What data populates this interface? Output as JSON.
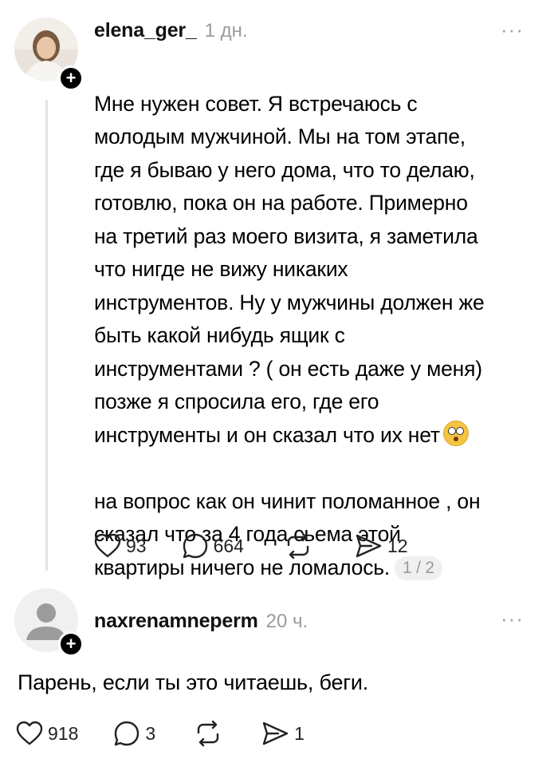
{
  "post": {
    "username": "elena_ger_",
    "time": "1 дн.",
    "more": "···",
    "follow_icon": "+",
    "text": "Мне нужен совет. Я встречаюсь с\nмолодым мужчиной. Мы на том этапе,\nгде я бываю у него дома, что то делаю,\nготовлю, пока он на работе. Примерно\nна третий раз моего визита, я заметила\nчто нигде не вижу никаких\nинструментов. Ну у мужчины должен же\nбыть какой нибудь ящик с\nинструментами ? ( он есть даже у меня)\nпозже я спросила его, где его\nинструменты и он сказал что их нет",
    "text2": "на вопрос как он чинит поломанное , он\nсказал что за 4 года сьема этой\nквартиры ничего не ломалось.",
    "emoji": "flushed-face-emoji",
    "pager": "1 / 2",
    "likes": "93",
    "comments": "664",
    "shares": "12"
  },
  "reply": {
    "username": "naxrenamneperm",
    "time": "20 ч.",
    "more": "···",
    "follow_icon": "+",
    "text": "Парень, если ты это читаешь, беги.",
    "likes": "918",
    "comments": "3",
    "shares": "1"
  },
  "icons": [
    "heart-icon",
    "comment-icon",
    "repost-icon",
    "send-icon"
  ],
  "colors": {
    "muted": "#9a9a9a",
    "line": "#e3e3e3"
  }
}
